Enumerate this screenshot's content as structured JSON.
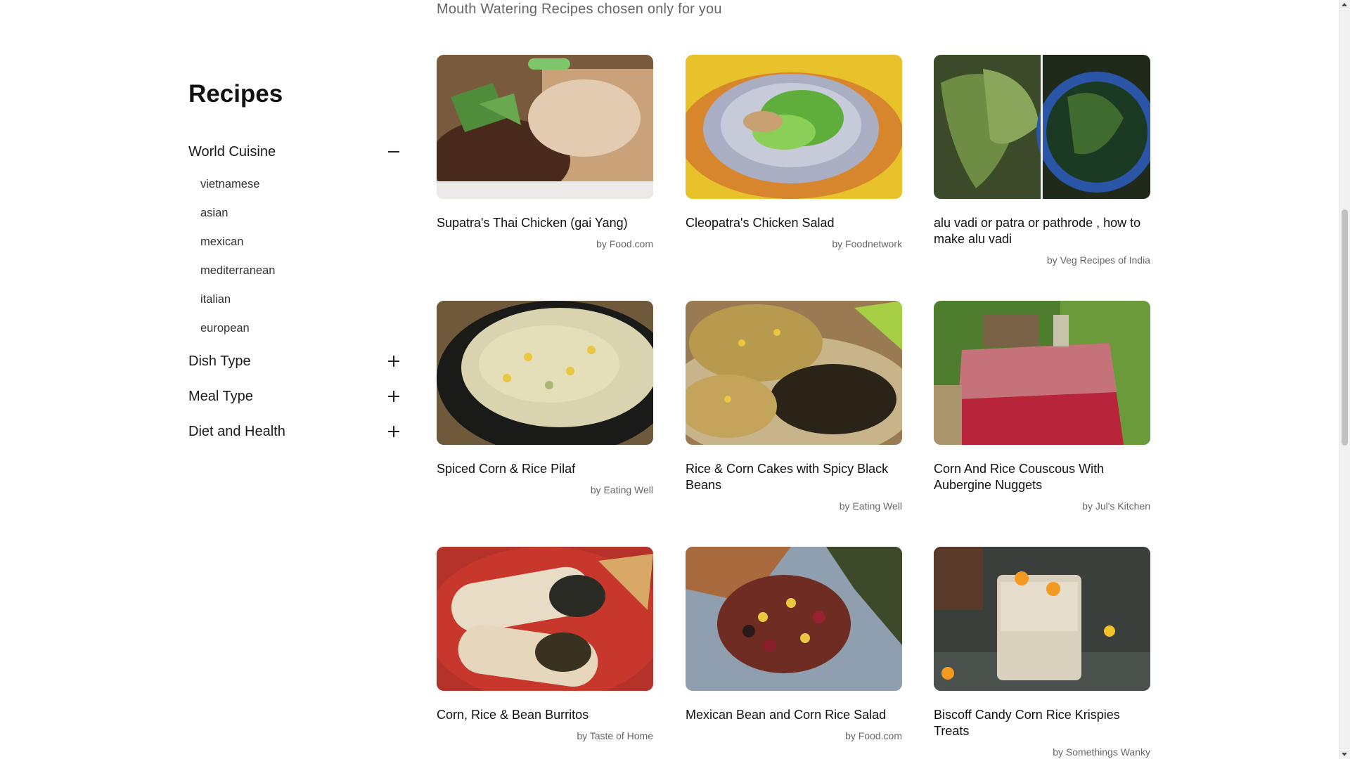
{
  "header": {
    "subtitle": "Mouth Watering Recipes chosen only for you"
  },
  "sidebar": {
    "title": "Recipes",
    "sections": [
      {
        "label": "World Cuisine",
        "expanded": true,
        "items": [
          "vietnamese",
          "asian",
          "mexican",
          "mediterranean",
          "italian",
          "european"
        ]
      },
      {
        "label": "Dish Type",
        "expanded": false
      },
      {
        "label": "Meal Type",
        "expanded": false
      },
      {
        "label": "Diet and Health",
        "expanded": false
      }
    ]
  },
  "recipes": [
    {
      "title": "Supatra's Thai Chicken (gai Yang)",
      "source": "by Food.com",
      "image": "grilled-chicken-photo"
    },
    {
      "title": "Cleopatra's Chicken Salad",
      "source": "by Foodnetwork",
      "image": "chicken-salad-photo"
    },
    {
      "title": "alu vadi or patra or pathrode , how to make alu vadi",
      "source": "by Veg Recipes of India",
      "image": "colocasia-leaves-photo"
    },
    {
      "title": "Spiced Corn & Rice Pilaf",
      "source": "by Eating Well",
      "image": "rice-pilaf-photo"
    },
    {
      "title": "Rice & Corn Cakes with Spicy Black Beans",
      "source": "by Eating Well",
      "image": "corn-cakes-photo"
    },
    {
      "title": "Corn And Rice Couscous With Aubergine Nuggets",
      "source": "by Jul's Kitchen",
      "image": "picnic-table-photo"
    },
    {
      "title": "Corn, Rice & Bean Burritos",
      "source": "by Taste of Home",
      "image": "burritos-photo"
    },
    {
      "title": "Mexican Bean and Corn Rice Salad",
      "source": "by Food.com",
      "image": "bean-salad-photo"
    },
    {
      "title": "Biscoff Candy Corn Rice Krispies Treats",
      "source": "by Somethings Wanky",
      "image": "krispies-treats-photo"
    }
  ]
}
